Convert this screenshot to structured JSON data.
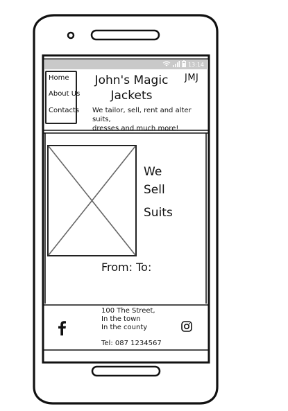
{
  "status_bar": {
    "time": "13:14",
    "icons": [
      "wifi-icon",
      "signal-icon",
      "battery-icon"
    ]
  },
  "header": {
    "nav": [
      "Home",
      "About Us",
      "Contacts"
    ],
    "title_line1": "John's Magic",
    "title_line2": "Jackets",
    "logo": "JMJ",
    "tagline_line1": "We tailor, sell, rent and alter suits,",
    "tagline_line2": "dresses and much more!"
  },
  "hero": {
    "image_icon": "image-placeholder-icon",
    "line1": "We",
    "line2": "Sell",
    "line3": "Suits",
    "price": "From: To:"
  },
  "footer": {
    "address_line1": "100 The Street,",
    "address_line2": "In the town",
    "address_line3": "In the county",
    "phone": "Tel: 087 1234567",
    "social_icons": [
      "facebook-icon",
      "instagram-icon"
    ]
  }
}
